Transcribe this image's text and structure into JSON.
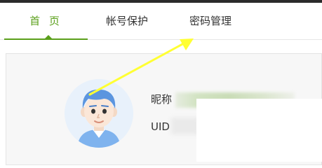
{
  "tabs": {
    "home": "首 页",
    "account_protection": "帐号保护",
    "password_management": "密码管理"
  },
  "profile": {
    "nickname_label": "昵称",
    "uid_label": "UID"
  },
  "colors": {
    "accent": "#5a9f1a",
    "annotation_arrow": "#ffff33"
  },
  "icons": {
    "avatar": "cartoon-boy-avatar",
    "arrow": "yellow-annotation-arrow"
  }
}
